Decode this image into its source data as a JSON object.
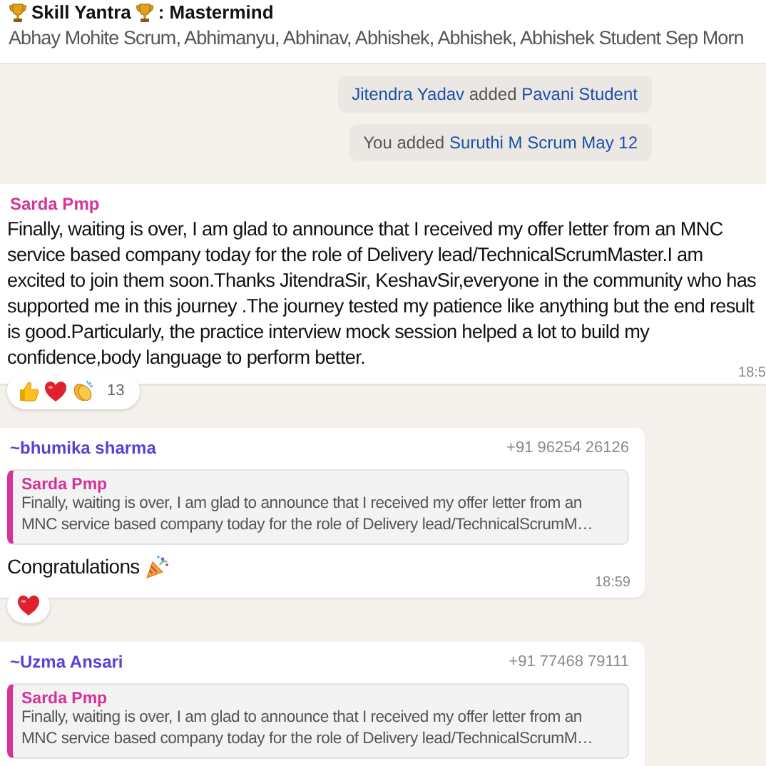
{
  "header": {
    "title_start": "Skill Yantra",
    "title_end": ": Mastermind",
    "members": "Abhay Mohite Scrum, Abhimanyu, Abhinav, Abhishek, Abhishek, Abhishek Student Sep Morn"
  },
  "events": [
    {
      "parts": [
        {
          "text": "Jitendra Yadav",
          "kind": "contact"
        },
        {
          "text": " added ",
          "kind": "plain"
        },
        {
          "text": "Pavani Student",
          "kind": "contact"
        }
      ]
    },
    {
      "parts": [
        {
          "text": "You added ",
          "kind": "plain"
        },
        {
          "text": "Suruthi M Scrum May 12",
          "kind": "contact"
        }
      ]
    }
  ],
  "messages": [
    {
      "kind": "text",
      "sender": "Sarda Pmp",
      "color": "#d6329a",
      "text": "Finally, waiting is over, I am glad to announce that I received my offer letter from an MNC service based company today for the role of Delivery lead/TechnicalScrumMaster.I am excited to join them soon.Thanks JitendraSir, KeshavSir,everyone in the community who has supported me in this journey .The journey tested my patience like anything but the end result is good.Particularly, the practice interview mock session helped a lot to build my confidence,body language to perform better.",
      "time": "18:5",
      "reactions": [
        {
          "kind": "thumbs-up"
        },
        {
          "kind": "heart"
        },
        {
          "kind": "clap"
        }
      ],
      "reaction_count": "13"
    },
    {
      "kind": "reply",
      "sender": "~bhumika sharma",
      "color": "#5b3fd6",
      "phone": "+91 96254 26126",
      "quote": {
        "sender": "Sarda Pmp",
        "color": "#d6329a",
        "text": "Finally, waiting is over, I am glad to announce that I received my offer letter from an MNC service based company today for the role of Delivery lead/TechnicalScrumM…"
      },
      "text": "Congratulations",
      "text_icon": {
        "kind": "party"
      },
      "time": "18:59",
      "reactions": [
        {
          "kind": "heart"
        }
      ]
    },
    {
      "kind": "reply",
      "sender": "~Uzma Ansari",
      "color": "#5b3fd6",
      "phone": "+91 77468 79111",
      "quote": {
        "sender": "Sarda Pmp",
        "color": "#d6329a",
        "text": "Finally, waiting is over, I am glad to announce that I received my offer letter from an MNC service based company today for the role of Delivery lead/TechnicalScrumM…"
      }
    }
  ]
}
